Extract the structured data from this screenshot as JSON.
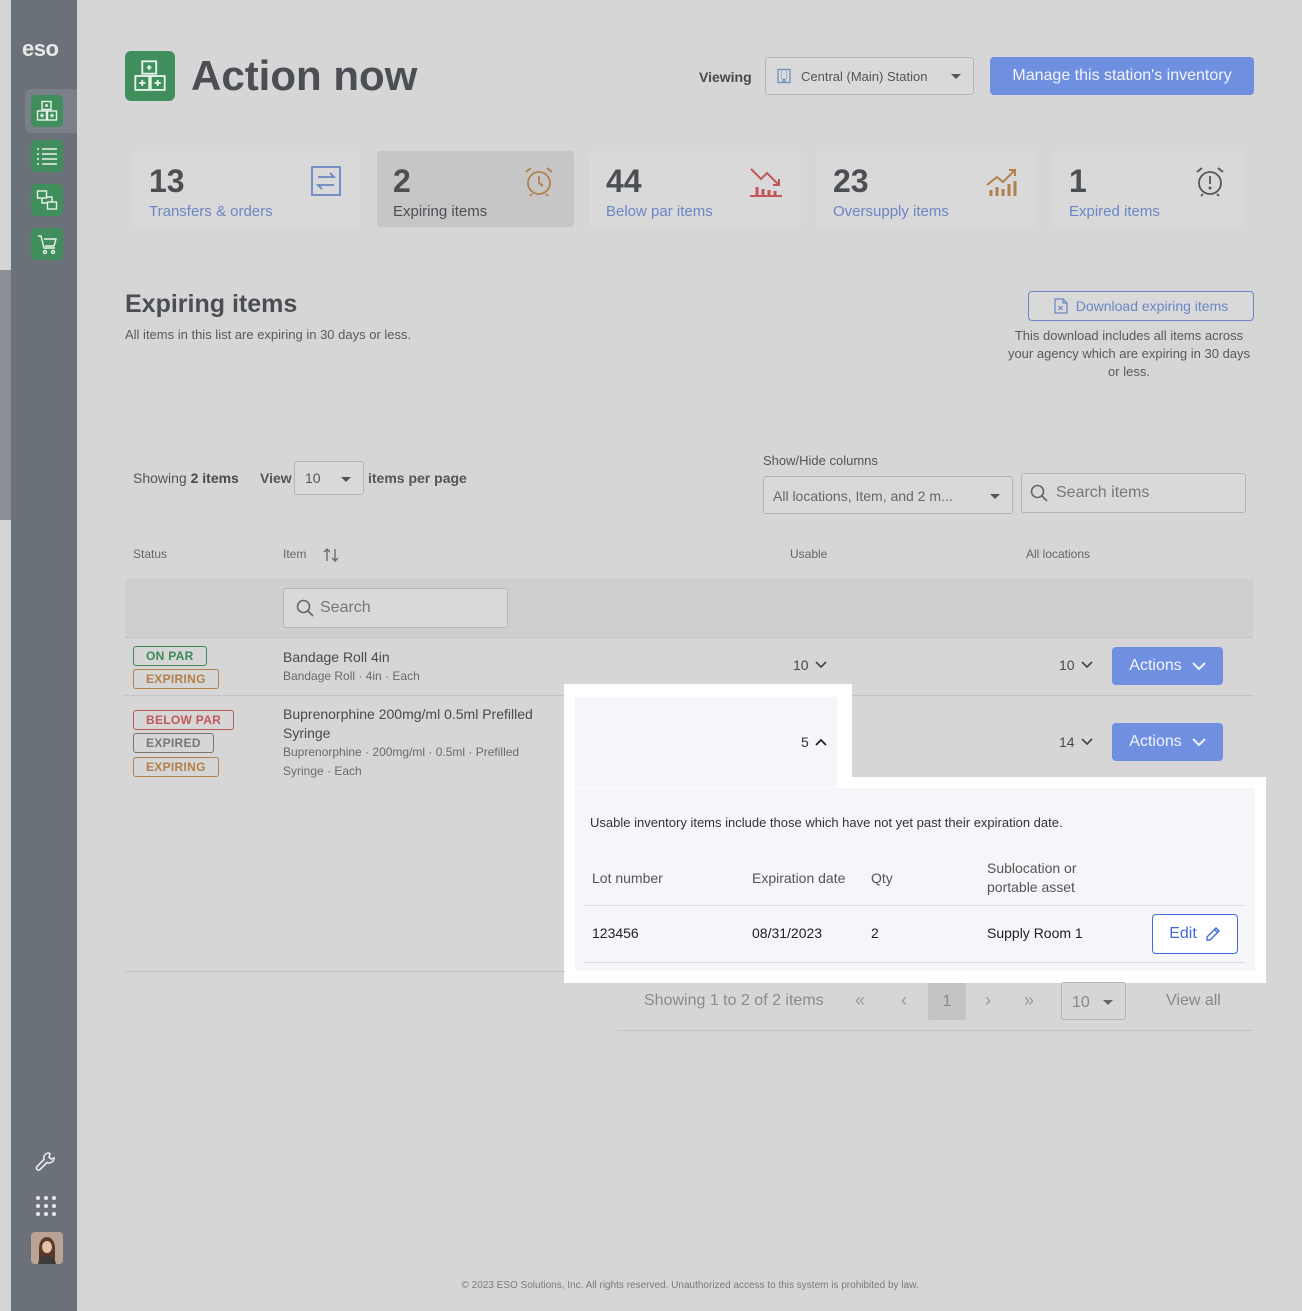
{
  "sidebar": {
    "logo": "eso",
    "nav": [
      {
        "icon": "boxes-icon"
      },
      {
        "icon": "list-icon"
      },
      {
        "icon": "transfer-icon"
      },
      {
        "icon": "cart-icon"
      }
    ],
    "bottom": [
      {
        "icon": "wrench-icon"
      },
      {
        "icon": "apps-grid-icon"
      },
      {
        "icon": "user-avatar"
      }
    ]
  },
  "header": {
    "title": "Action now",
    "viewing_label": "Viewing",
    "station": "Central (Main) Station",
    "manage_button": "Manage this station's inventory"
  },
  "cards": [
    {
      "count": "13",
      "label": "Transfers & orders",
      "icon": "transfer-arrows-icon",
      "color": "#6b86c4"
    },
    {
      "count": "2",
      "label": "Expiring items",
      "icon": "alarm-clock-icon",
      "color": "#b0814a",
      "active": true
    },
    {
      "count": "44",
      "label": "Below par items",
      "icon": "trend-down-icon",
      "color": "#c2575a"
    },
    {
      "count": "23",
      "label": "Oversupply items",
      "icon": "trend-up-icon",
      "color": "#b0814a"
    },
    {
      "count": "1",
      "label": "Expired items",
      "icon": "alarm-alert-icon",
      "color": "#555555"
    }
  ],
  "section": {
    "title": "Expiring items",
    "subtitle": "All items in this list are expiring in 30 days or less.",
    "download_button": "Download expiring items",
    "download_note": "This download includes all items across your agency which are expiring in 30 days or less."
  },
  "controls": {
    "showing_prefix": "Showing",
    "showing_count": "2 items",
    "view_label": "View",
    "per_page": "10",
    "per_page_label": "items per page",
    "show_hide_label": "Show/Hide columns",
    "columns_value": "All locations, Item, and 2 m...",
    "search_placeholder": "Search items"
  },
  "table": {
    "headers": {
      "status": "Status",
      "item": "Item",
      "usable": "Usable",
      "all_locations": "All locations"
    },
    "filter_placeholder": "Search",
    "rows": [
      {
        "badges": [
          "ON PAR",
          "EXPIRING"
        ],
        "name": "Bandage Roll 4in",
        "desc": "Bandage Roll · 4in · Each",
        "usable": "10",
        "all_locations": "10",
        "actions": "Actions"
      },
      {
        "badges": [
          "BELOW PAR",
          "EXPIRED",
          "EXPIRING"
        ],
        "name_line1": "Buprenorphine 200mg/ml 0.5ml Prefilled",
        "name_line2": "Syringe",
        "desc_line1": "Buprenorphine · 200mg/ml · 0.5ml · Prefilled",
        "desc_line2": "Syringe · Each",
        "usable": "5",
        "all_locations": "14",
        "actions": "Actions"
      }
    ]
  },
  "expanded": {
    "note": "Usable inventory items include those which have not yet past their expiration date.",
    "headers": {
      "lot": "Lot number",
      "exp": "Expiration date",
      "qty": "Qty",
      "subloc_1": "Sublocation or",
      "subloc_2": "portable asset"
    },
    "row": {
      "lot": "123456",
      "exp": "08/31/2023",
      "qty": "2",
      "subloc": "Supply Room 1",
      "edit": "Edit"
    }
  },
  "pagination": {
    "showing": "Showing 1 to 2 of 2 items",
    "first": "«",
    "prev": "‹",
    "current": "1",
    "next": "›",
    "last": "»",
    "per_page": "10",
    "view_all": "View all"
  },
  "footer": "© 2023 ESO Solutions, Inc. All rights reserved. Unauthorized access to this system is prohibited by law."
}
